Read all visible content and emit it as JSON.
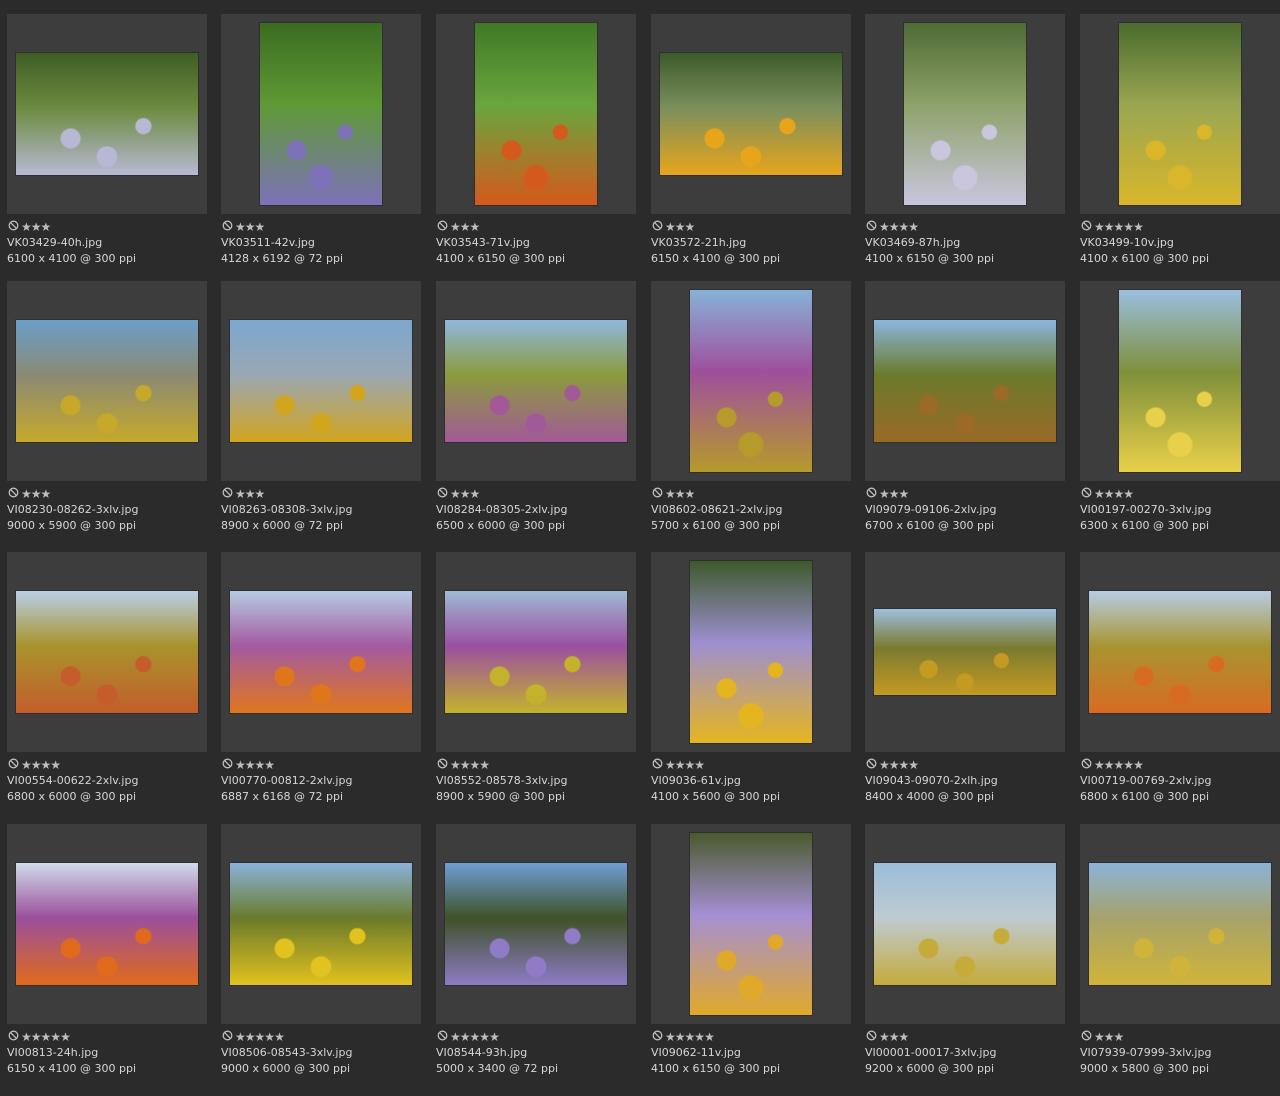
{
  "gallery": {
    "items": [
      {
        "filename": "VK03429-40h.jpg",
        "dimensions": "6100 x 4100 @ 300 ppi",
        "rating": 3,
        "orientation": "landscape",
        "colors": [
          "#3e5d24",
          "#6d8a3f",
          "#b7b9d4"
        ]
      },
      {
        "filename": "VK03511-42v.jpg",
        "dimensions": "4128 x 6192 @ 72 ppi",
        "rating": 3,
        "orientation": "portrait",
        "colors": [
          "#3b6b22",
          "#5e9a35",
          "#7d71b8"
        ]
      },
      {
        "filename": "VK03543-71v.jpg",
        "dimensions": "4100 x 6150 @ 300 ppi",
        "rating": 3,
        "orientation": "portrait",
        "colors": [
          "#3f7a26",
          "#69a63e",
          "#d4591c"
        ]
      },
      {
        "filename": "VK03572-21h.jpg",
        "dimensions": "6150 x 4100 @ 300 ppi",
        "rating": 3,
        "orientation": "landscape",
        "colors": [
          "#3d5b2a",
          "#7b8f5c",
          "#e8a51c"
        ]
      },
      {
        "filename": "VK03469-87h.jpg",
        "dimensions": "4100 x 6150 @ 300 ppi",
        "rating": 4,
        "orientation": "portrait",
        "colors": [
          "#4d6b33",
          "#8ea26a",
          "#c9c6de"
        ]
      },
      {
        "filename": "VK03499-10v.jpg",
        "dimensions": "4100 x 6100 @ 300 ppi",
        "rating": 5,
        "orientation": "portrait",
        "colors": [
          "#4a6b2c",
          "#9aa652",
          "#d9b62a"
        ]
      },
      {
        "filename": "VI08230-08262-3xlv.jpg",
        "dimensions": "9000 x 5900 @ 300 ppi",
        "rating": 3,
        "orientation": "landscape",
        "colors": [
          "#6b9ec9",
          "#8a8a74",
          "#c6a92a"
        ]
      },
      {
        "filename": "VI08263-08308-3xlv.jpg",
        "dimensions": "8900 x 6000 @ 72 ppi",
        "rating": 3,
        "orientation": "landscape",
        "colors": [
          "#7ba7cf",
          "#9aa7b4",
          "#d1a51d"
        ]
      },
      {
        "filename": "VI08284-08305-2xlv.jpg",
        "dimensions": "6500 x 6000 @ 300 ppi",
        "rating": 3,
        "orientation": "landscape",
        "colors": [
          "#8fb7dd",
          "#8b9b3c",
          "#a15a97"
        ]
      },
      {
        "filename": "VI08602-08621-2xlv.jpg",
        "dimensions": "5700 x 6100 @ 300 ppi",
        "rating": 3,
        "orientation": "portrait",
        "colors": [
          "#86b2d8",
          "#9e4f9c",
          "#b69a2b"
        ]
      },
      {
        "filename": "VI09079-09106-2xlv.jpg",
        "dimensions": "6700 x 6100 @ 300 ppi",
        "rating": 3,
        "orientation": "landscape",
        "colors": [
          "#8bb6dd",
          "#6b7a2c",
          "#9a6a26"
        ]
      },
      {
        "filename": "VI00197-00270-3xlv.jpg",
        "dimensions": "6300 x 6100 @ 300 ppi",
        "rating": 4,
        "orientation": "portrait",
        "colors": [
          "#9bbfe0",
          "#7e8f3a",
          "#e9d04a"
        ]
      },
      {
        "filename": "VI00554-00622-2xlv.jpg",
        "dimensions": "6800 x 6000 @ 300 ppi",
        "rating": 4,
        "orientation": "landscape",
        "colors": [
          "#b9cfe6",
          "#a8932d",
          "#c45d2b"
        ]
      },
      {
        "filename": "VI00770-00812-2xlv.jpg",
        "dimensions": "6887 x 6168 @ 72 ppi",
        "rating": 4,
        "orientation": "landscape",
        "colors": [
          "#b5cbe2",
          "#a35aa2",
          "#e0761c"
        ]
      },
      {
        "filename": "VI08552-08578-3xlv.jpg",
        "dimensions": "8900 x 5900 @ 300 ppi",
        "rating": 4,
        "orientation": "landscape",
        "colors": [
          "#9ebbd6",
          "#9b4fa1",
          "#c4b22c"
        ]
      },
      {
        "filename": "VI09036-61v.jpg",
        "dimensions": "4100 x 5600 @ 300 ppi",
        "rating": 4,
        "orientation": "portrait",
        "colors": [
          "#3d5a2b",
          "#9d8fd0",
          "#e5b51f"
        ]
      },
      {
        "filename": "VI09043-09070-2xlh.jpg",
        "dimensions": "8400 x 4000 @ 300 ppi",
        "rating": 4,
        "orientation": "wide",
        "colors": [
          "#9dbfe0",
          "#7a7a30",
          "#c49a22"
        ]
      },
      {
        "filename": "VI00719-00769-2xlv.jpg",
        "dimensions": "6800 x 6100 @ 300 ppi",
        "rating": 5,
        "orientation": "landscape",
        "colors": [
          "#b6cde4",
          "#a89532",
          "#d86b22"
        ]
      },
      {
        "filename": "VI00813-24h.jpg",
        "dimensions": "6150 x 4100 @ 300 ppi",
        "rating": 5,
        "orientation": "landscape",
        "colors": [
          "#cfdcea",
          "#9b4f9c",
          "#e06a1b"
        ]
      },
      {
        "filename": "VI08506-08543-3xlv.jpg",
        "dimensions": "9000 x 6000 @ 300 ppi",
        "rating": 5,
        "orientation": "landscape",
        "colors": [
          "#8ab3da",
          "#6a7a2b",
          "#e2c21e"
        ]
      },
      {
        "filename": "VI08544-93h.jpg",
        "dimensions": "5000 x 3400 @ 72 ppi",
        "rating": 5,
        "orientation": "landscape",
        "colors": [
          "#6e9fd6",
          "#3f5228",
          "#8f7bc6"
        ]
      },
      {
        "filename": "VI09062-11v.jpg",
        "dimensions": "4100 x 6150 @ 300 ppi",
        "rating": 5,
        "orientation": "portrait",
        "colors": [
          "#4a5a2c",
          "#a58fd4",
          "#e0a92a"
        ]
      },
      {
        "filename": "VI00001-00017-3xlv.jpg",
        "dimensions": "9200 x 6000 @ 300 ppi",
        "rating": 3,
        "orientation": "landscape",
        "colors": [
          "#9bbcd9",
          "#bfcbd2",
          "#c4ab3a"
        ]
      },
      {
        "filename": "VI07939-07999-3xlv.jpg",
        "dimensions": "9000 x 5800 @ 300 ppi",
        "rating": 3,
        "orientation": "landscape",
        "colors": [
          "#8bb3d8",
          "#a6a26a",
          "#d0b43a"
        ]
      }
    ]
  }
}
